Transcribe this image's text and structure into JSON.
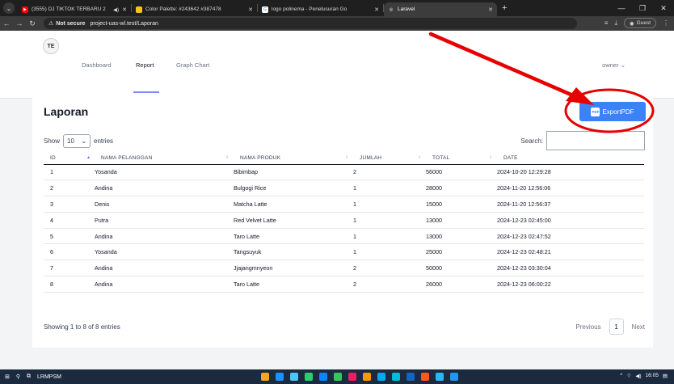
{
  "browser": {
    "tabs": [
      {
        "title": "(3555) DJ TIKTOK TERBARU 2",
        "audio": "◀)",
        "fav_color": "#ff0000",
        "fav_glyph": "▶"
      },
      {
        "title": "Color Palette: #243642 #387478",
        "fav_color": "#f5c518",
        "fav_glyph": ""
      },
      {
        "title": "logo polinema - Penelusuran Go",
        "fav_color": "#ffffff",
        "fav_glyph": "G"
      },
      {
        "title": "Laravel",
        "fav_color": "#3c3c3c",
        "fav_glyph": "◎"
      }
    ],
    "not_secure": "Not secure",
    "url": "project-uas-wl.test/Laporan",
    "profile": "Guest"
  },
  "nav": {
    "logo_text": "TE",
    "links": [
      {
        "label": "Dashboard"
      },
      {
        "label": "Report"
      },
      {
        "label": "Graph Chart"
      }
    ],
    "user": "owner"
  },
  "page": {
    "title": "Laporan",
    "export_label": "ExportPDF",
    "pdf_icon": "PDF",
    "show_label": "Show",
    "entries_value": "10",
    "entries_label": "entries",
    "search_label": "Search:",
    "columns": [
      "ID",
      "NAMA PELANGGAN",
      "NAMA PRODUK",
      "JUMLAH",
      "TOTAL",
      "DATE"
    ],
    "rows": [
      [
        "1",
        "Yosanda",
        "Bibimbap",
        "2",
        "56000",
        "2024-10-20 12:29:28"
      ],
      [
        "2",
        "Andina",
        "Bulgogi Rice",
        "1",
        "28000",
        "2024-11-20 12:56:06"
      ],
      [
        "3",
        "Denis",
        "Matcha Latte",
        "1",
        "15000",
        "2024-11-20 12:56:37"
      ],
      [
        "4",
        "Putra",
        "Red Velvet Latte",
        "1",
        "13000",
        "2024-12-23 02:45:00"
      ],
      [
        "5",
        "Andina",
        "Taro Latte",
        "1",
        "13000",
        "2024-12-23 02:47:52"
      ],
      [
        "6",
        "Yosanda",
        "Tangsuyuk",
        "1",
        "25000",
        "2024-12-23 02:48:21"
      ],
      [
        "7",
        "Andina",
        "Jjajangmnyeon",
        "2",
        "50000",
        "2024-12-23 03:30:04"
      ],
      [
        "8",
        "Andina",
        "Taro Latte",
        "2",
        "26000",
        "2024-12-23 06:00:22"
      ]
    ],
    "info": "Showing 1 to 8 of 8 entries",
    "prev": "Previous",
    "current_page": "1",
    "next": "Next"
  },
  "taskbar": {
    "label": "LRMPSM",
    "time": "16:05",
    "app_colors": [
      "#f5a623",
      "#1e90ff",
      "#4fc3f7",
      "#2ecc71",
      "#0a84ff",
      "#34c759",
      "#e91e63",
      "#ff9800",
      "#03a9f4",
      "#00bcd4",
      "#1565c0",
      "#ff5722",
      "#29b6f6",
      "#2196f3"
    ]
  },
  "colors": {
    "accent": "#3b82f6",
    "annotation": "#e60000",
    "nav_active": "#818cf8"
  }
}
